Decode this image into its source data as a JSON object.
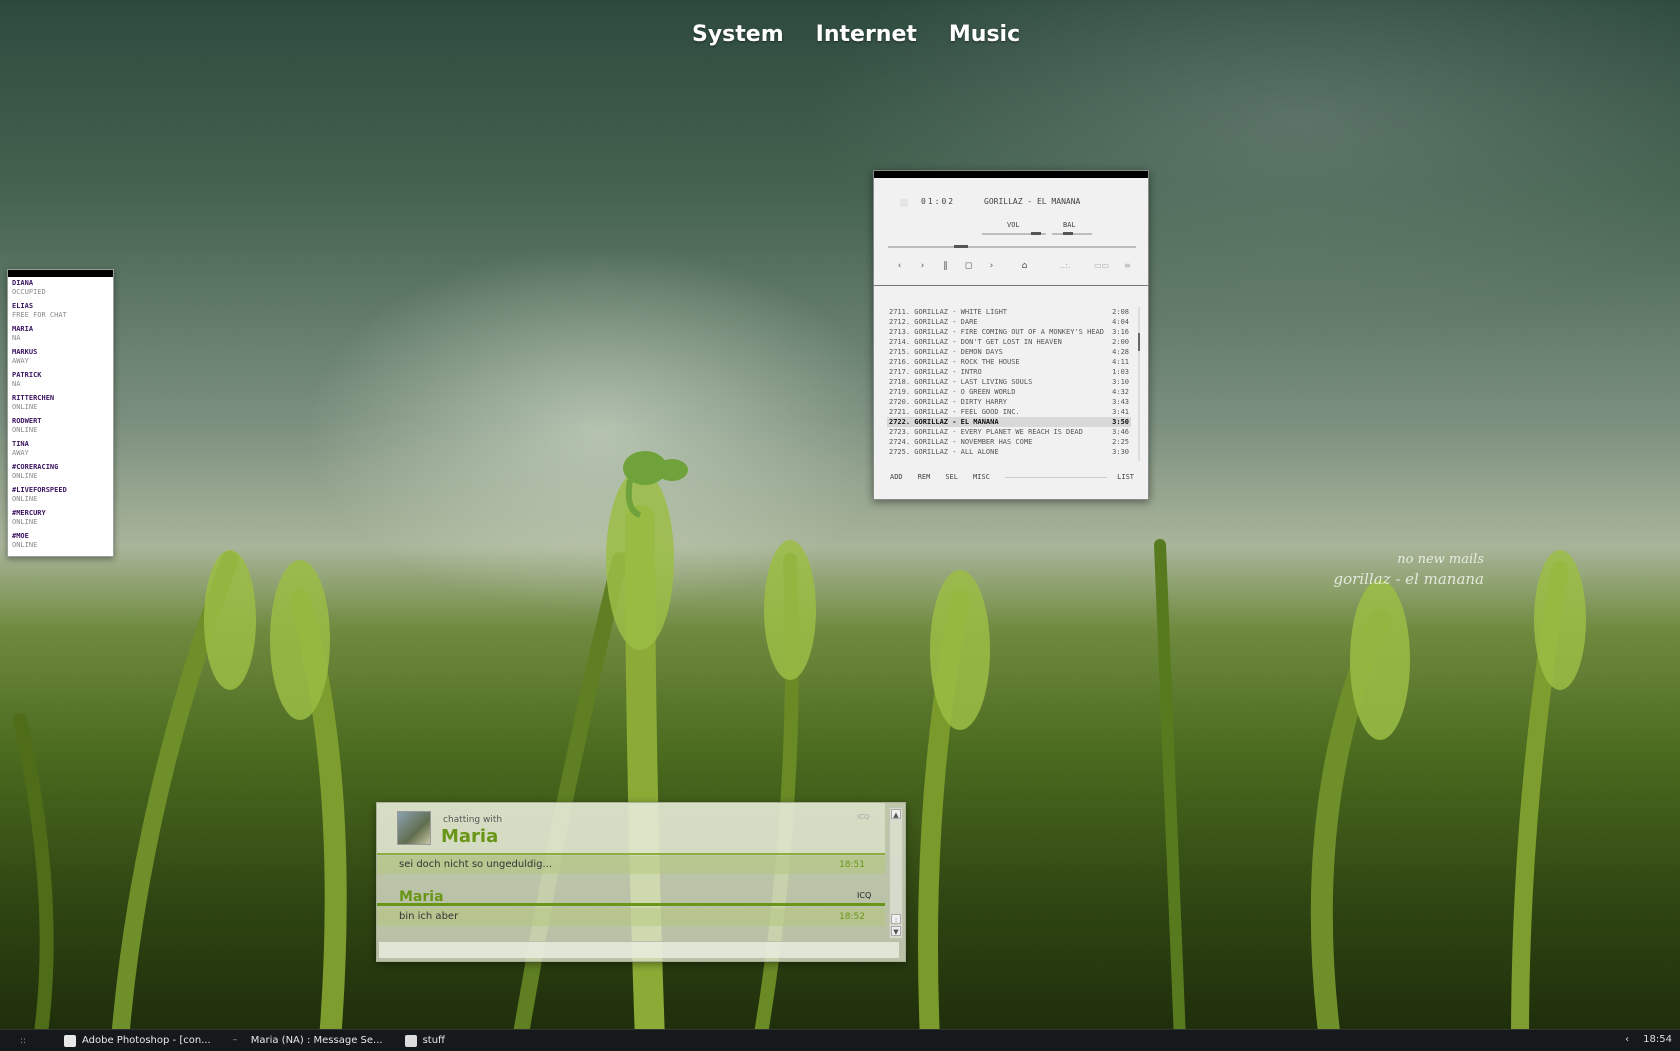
{
  "top_menu": [
    "System",
    "Internet",
    "Music"
  ],
  "contacts": [
    {
      "name": "DIANA",
      "status": "OCCUPIED"
    },
    {
      "name": "ELIAS",
      "status": "FREE FOR CHAT"
    },
    {
      "name": "MARIA",
      "status": "NA"
    },
    {
      "name": "MARKUS",
      "status": "AWAY"
    },
    {
      "name": "PATRICK",
      "status": "NA"
    },
    {
      "name": "RITTERCHEN",
      "status": "ONLINE"
    },
    {
      "name": "RODWERT",
      "status": "ONLINE"
    },
    {
      "name": "TINA",
      "status": "AWAY"
    },
    {
      "name": "#CORERACING",
      "status": "ONLINE"
    },
    {
      "name": "#LIVEFORSPEED",
      "status": "ONLINE"
    },
    {
      "name": "#MERCURY",
      "status": "ONLINE"
    },
    {
      "name": "#MOE",
      "status": "ONLINE"
    }
  ],
  "player": {
    "time": "01:02",
    "title": "GORILLAZ - EL MANANA",
    "vol_label": "VOL",
    "bal_label": "BAL",
    "buttons": [
      "‹",
      "›",
      "‖",
      "◻",
      "›",
      "⌂"
    ],
    "aux": [
      "..:.",
      "▭▭",
      "≡"
    ],
    "playlist": [
      {
        "t": "2711. GORILLAZ - WHITE LIGHT",
        "d": "2:08"
      },
      {
        "t": "2712. GORILLAZ - DARE",
        "d": "4:04"
      },
      {
        "t": "2713. GORILLAZ - FIRE COMING OUT OF A MONKEY'S HEAD",
        "d": "3:16"
      },
      {
        "t": "2714. GORILLAZ - DON'T GET LOST IN HEAVEN",
        "d": "2:00"
      },
      {
        "t": "2715. GORILLAZ - DEMON DAYS",
        "d": "4:28"
      },
      {
        "t": "2716. GORILLAZ - ROCK THE HOUSE",
        "d": "4:11"
      },
      {
        "t": "2717. GORILLAZ - INTRO",
        "d": "1:03"
      },
      {
        "t": "2718. GORILLAZ - LAST LIVING SOULS",
        "d": "3:10"
      },
      {
        "t": "2719. GORILLAZ - O GREEN WORLD",
        "d": "4:32"
      },
      {
        "t": "2720. GORILLAZ - DIRTY HARRY",
        "d": "3:43"
      },
      {
        "t": "2721. GORILLAZ - FEEL GOOD INC.",
        "d": "3:41"
      },
      {
        "t": "2722. GORILLAZ - EL MANANA",
        "d": "3:50"
      },
      {
        "t": "2723. GORILLAZ - EVERY PLANET WE REACH IS DEAD",
        "d": "3:46"
      },
      {
        "t": "2724. GORILLAZ - NOVEMBER HAS COME",
        "d": "2:25"
      },
      {
        "t": "2725. GORILLAZ - ALL ALONE",
        "d": "3:30"
      }
    ],
    "selected_index": 11,
    "bottom": {
      "add": "ADD",
      "rem": "REM",
      "sel": "SEL",
      "misc": "MISC",
      "list": "LIST"
    }
  },
  "desktop_text": {
    "mail": "no new mails",
    "now_playing": "gorillaz - el manana"
  },
  "chat": {
    "chatting_with": "chatting with",
    "contact": "Maria",
    "protocol_header": "ICQ",
    "messages": [
      {
        "text": "sei doch nicht so ungeduldig...",
        "time": "18:51"
      },
      {
        "text": "bin ich aber",
        "time": "18:52"
      }
    ],
    "sender": "Maria",
    "protocol": "ICQ"
  },
  "taskbar": {
    "tasks": [
      "Adobe Photoshop - [con...",
      "Maria (NA) : Message Se...",
      "stuff"
    ],
    "clock": "18:54"
  }
}
